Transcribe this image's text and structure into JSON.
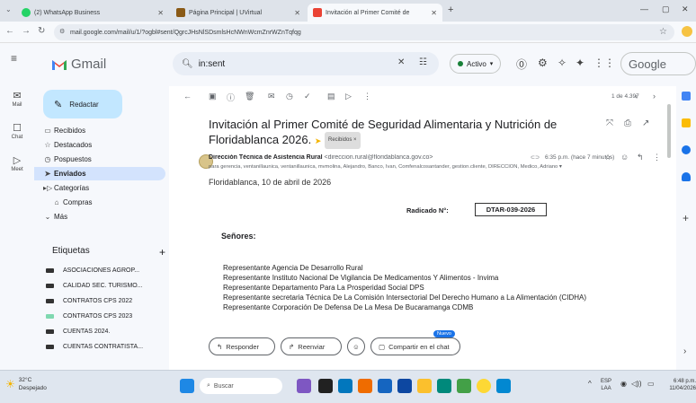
{
  "browser": {
    "tabs": [
      {
        "title": "(2) WhatsApp Business",
        "color": "#25d366"
      },
      {
        "title": "Página Principal | UVirtual",
        "color": "#8a5a16"
      },
      {
        "title": "Invitación al Primer Comité de",
        "color": "#ea4335"
      }
    ],
    "url": "mail.google.com/mail/u/1/?ogbl#sent/QgrcJHsNlSDsmlsHcNWnWcmZnrWZnTqfqg"
  },
  "gmail": {
    "logo": "Gmail",
    "compose_label": "Redactar",
    "search_value": "in:sent",
    "status_label": "Activo",
    "google_label": "Google",
    "rail": [
      {
        "label": "Mail",
        "icon": "mail-icon"
      },
      {
        "label": "Chat",
        "icon": "chat-icon"
      },
      {
        "label": "Meet",
        "icon": "meet-icon"
      }
    ],
    "nav": [
      {
        "label": "Recibidos",
        "icon": "inbox-icon"
      },
      {
        "label": "Destacados",
        "icon": "star-icon"
      },
      {
        "label": "Pospuestos",
        "icon": "clock-icon"
      },
      {
        "label": "Enviados",
        "icon": "send-icon"
      },
      {
        "label": "Categorías",
        "icon": "label-icon"
      },
      {
        "label": "Compras",
        "icon": "tag-icon"
      },
      {
        "label": "Más",
        "icon": "chevron-down-icon"
      }
    ],
    "labels_title": "Etiquetas",
    "labels": [
      {
        "label": "ASOCIACIONES AGROP...",
        "color": "#202124"
      },
      {
        "label": "CALIDAD SEC. TURISMO...",
        "color": "#202124"
      },
      {
        "label": "CONTRATOS CPS 2022",
        "color": "#202124"
      },
      {
        "label": "CONTRATOS CPS 2023",
        "color": "#7fd8b0"
      },
      {
        "label": "CUENTAS 2024.",
        "color": "#202124"
      },
      {
        "label": "CUENTAS CONTRATISTA...",
        "color": "#202124"
      }
    ]
  },
  "message": {
    "pagination": "1 de 4.397",
    "subject": "Invitación al Primer Comité de Seguridad Alimentaria y Nutrición de Floridablanca 2026.",
    "inbox_badge": "Recibidos ×",
    "sender_name": "Dirección Técnica de Asistencia Rural",
    "sender_email": "<direccion.rural@floridablanca.gov.co>",
    "time": "6:35 p.m. (hace 7 minutos)",
    "recipients": "para gerencia, ventanillaunica, ventanillaunica, mvmolina, Alejandro, Banco, Ivan, Comfenalcosantander, gestion.cliente, DIRECCIÓN, Medico, Adriano",
    "date_line": "Floridablanca, 10 de abril de 2026",
    "radicado_label": "Radicado N°:",
    "radicado_value": "DTAR-039-2026",
    "greeting": "Señores:",
    "lines": [
      "Representante Agencia De Desarrollo Rural",
      "Representante Instituto Nacional De Vigilancia De Medicamentos Y Alimentos - Invima",
      "Representante Departamento Para La Prosperidad Social DPS",
      "Representante secretaria Técnica De La Comisión Intersectorial Del Derecho Humano a La Alimentación (CIDHA)",
      "Representante Corporación De Defensa De La Mesa De Bucaramanga CDMB"
    ],
    "reply_label": "Responder",
    "forward_label": "Reenviar",
    "share_label": "Compartir en el chat",
    "new_badge": "Nuevo"
  },
  "taskbar": {
    "weather_temp": "32°C",
    "weather_text": "Despejado",
    "search_placeholder": "Buscar",
    "lang": "ESP",
    "lang2": "LAA",
    "time": "6:48 p.m.",
    "date": "11/04/2026"
  }
}
